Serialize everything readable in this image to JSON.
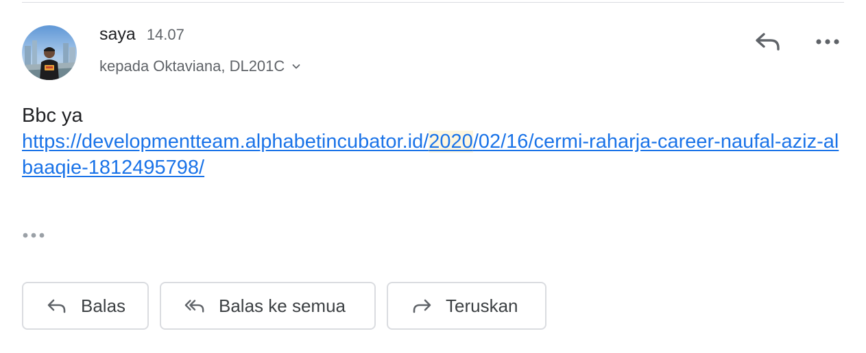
{
  "message": {
    "sender_name": "saya",
    "time": "14.07",
    "recipients": "kepada Oktaviana, DL201C",
    "body_text": "Bbc ya",
    "link_before_highlight": "https://developmentteam.alphabetincubator.id/",
    "link_highlight": "2020",
    "link_after_highlight": "/02/16/cermi-raharja-career-naufal-aziz-albaaqie-1812495798/"
  },
  "actions": {
    "reply_label": "Balas",
    "reply_all_label": "Balas ke semua",
    "forward_label": "Teruskan"
  },
  "icons": {
    "top_reply": "reply-icon",
    "top_more": "more-horizontal-icon",
    "recipients_toggle": "chevron-down-icon",
    "expand": "more-horizontal-icon",
    "reply": "reply-icon",
    "reply_all": "reply-all-icon",
    "forward": "forward-icon"
  },
  "colors": {
    "link": "#1a73e8",
    "highlight": "#fdf6e0",
    "secondary_text": "#5f6368",
    "border": "#dadce0"
  }
}
